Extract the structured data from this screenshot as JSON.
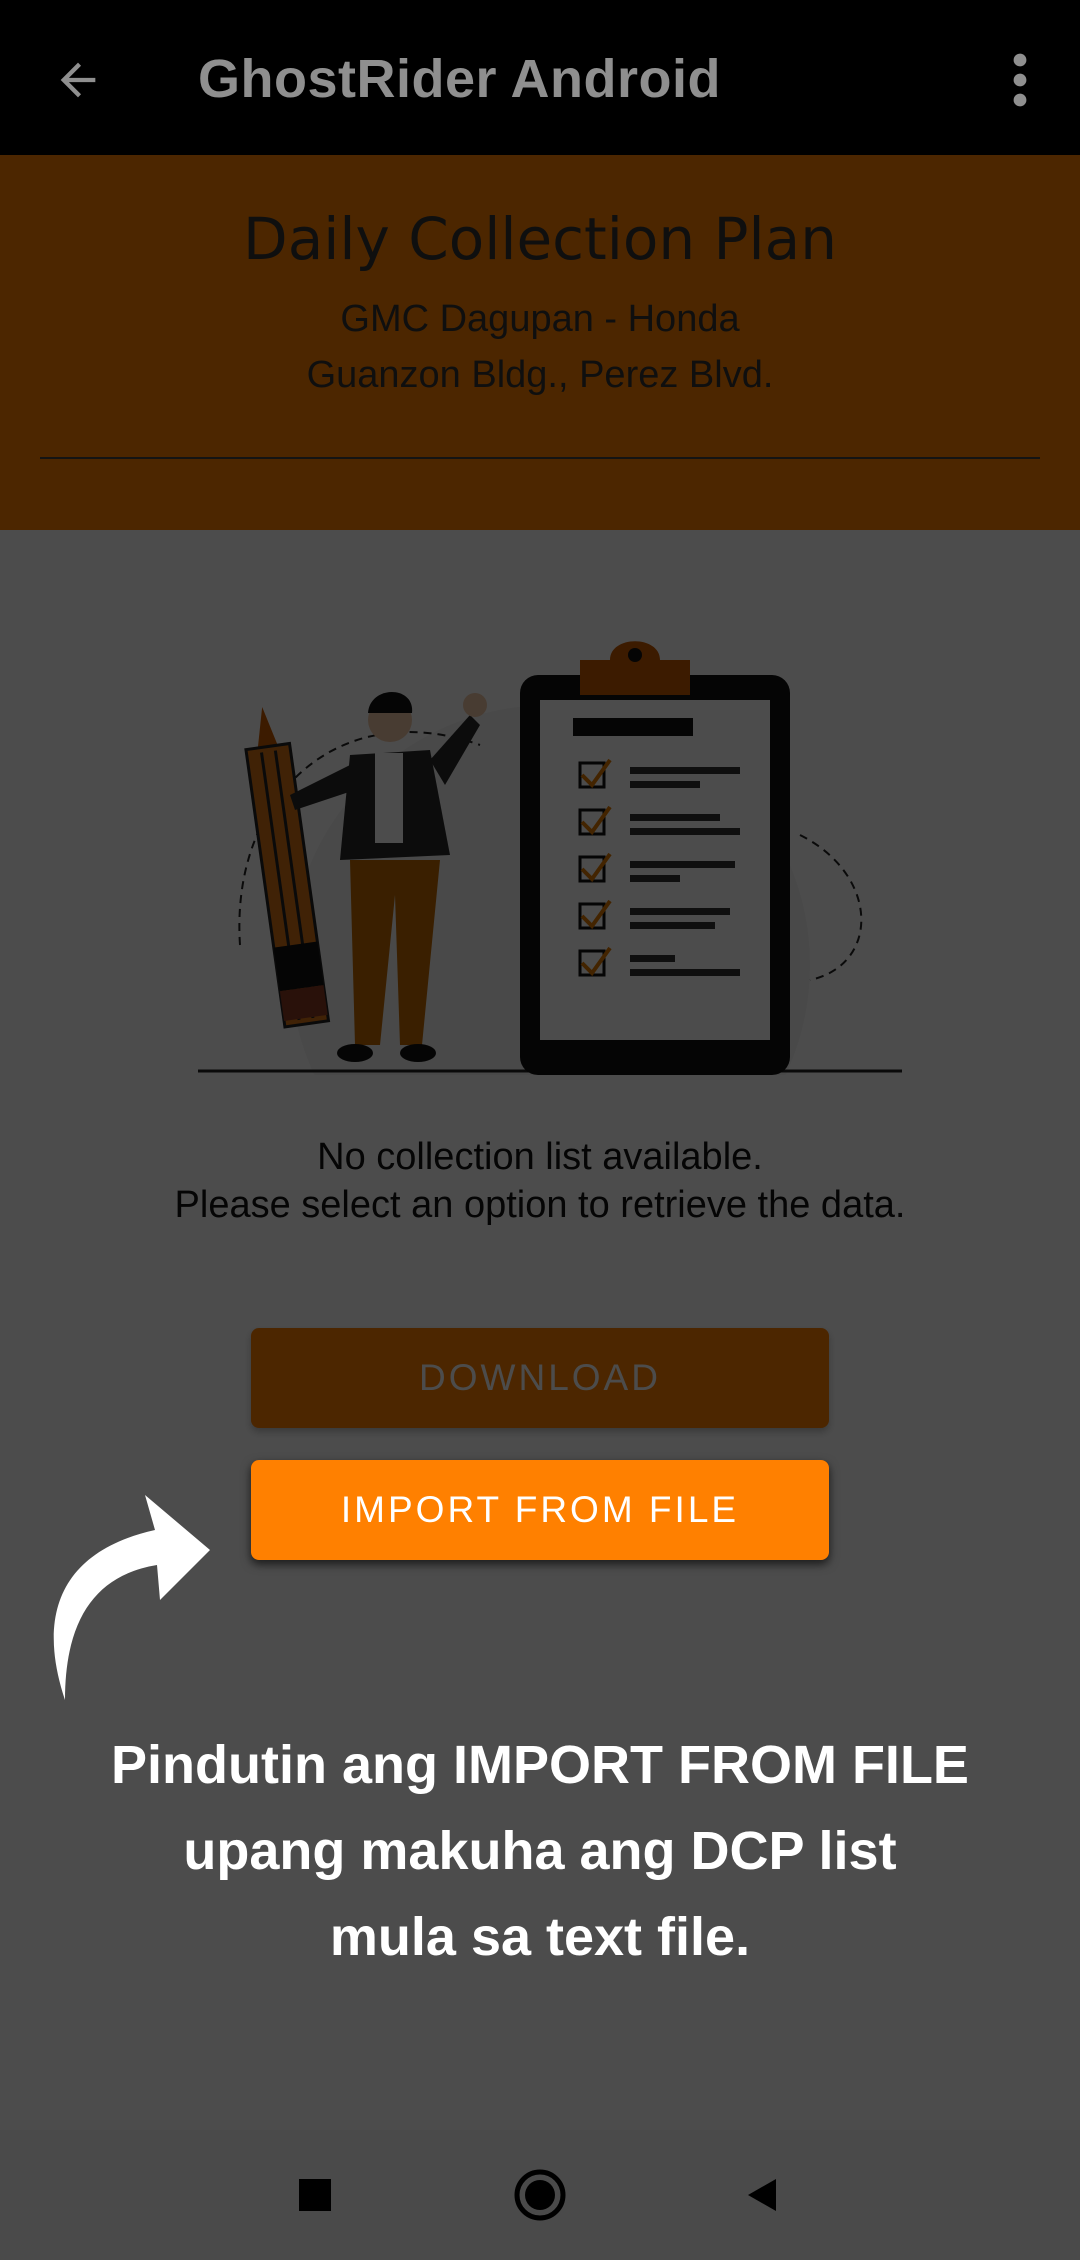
{
  "appbar": {
    "title": "GhostRider Android",
    "back_icon": "arrow-left-icon",
    "menu_icon": "more-vert-icon"
  },
  "header": {
    "title": "Daily Collection Plan",
    "branch_line1": "GMC Dagupan - Honda",
    "branch_line2": "Guanzon Bldg., Perez Blvd."
  },
  "empty_state": {
    "illustration": "person-with-pencil-and-checklist-clipboard",
    "line1": "No collection list available.",
    "line2": "Please select an option to retrieve the data."
  },
  "buttons": {
    "download_label": "DOWNLOAD",
    "import_label": "IMPORT FROM FILE"
  },
  "tutorial": {
    "line1": "Pindutin ang IMPORT FROM FILE",
    "line2": "upang makuha ang DCP list",
    "line3": "mula sa text file.",
    "pointer_icon": "curved-arrow-icon"
  },
  "navbar": {
    "recents_icon": "square-icon",
    "home_icon": "circle-icon",
    "back_icon": "triangle-back-icon"
  },
  "colors": {
    "accent": "#FF8000",
    "appbar": "#000000",
    "scrim": "rgba(0,0,0,0.70)"
  }
}
